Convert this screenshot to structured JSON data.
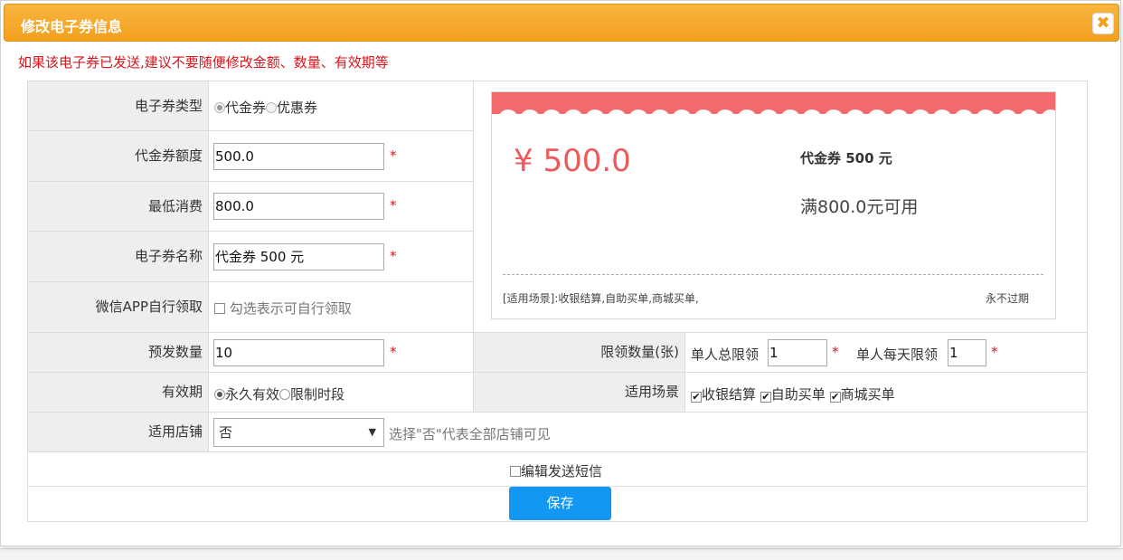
{
  "dialog": {
    "title": "修改电子券信息",
    "close_symbol": "✖",
    "warning": "如果该电子券已发送,建议不要随便修改金额、数量、有效期等"
  },
  "form": {
    "coupon_type": {
      "label": "电子券类型",
      "options": [
        "代金券",
        "优惠券"
      ],
      "selected": "代金券"
    },
    "amount": {
      "label": "代金券额度",
      "value": "500.0",
      "required": "*"
    },
    "min_spend": {
      "label": "最低消费",
      "value": "800.0",
      "required": "*"
    },
    "name": {
      "label": "电子券名称",
      "value": "代金券 500 元",
      "required": "*"
    },
    "wechat_self_claim": {
      "label": "微信APP自行领取",
      "checkbox_text": "勾选表示可自行领取",
      "checked": false
    },
    "preissue_qty": {
      "label": "预发数量",
      "value": "10",
      "required": "*"
    },
    "claim_limit": {
      "label": "限领数量(张)",
      "total_label": "单人总限领",
      "total_value": "1",
      "daily_label": "单人每天限领",
      "daily_value": "1",
      "required": "*"
    },
    "validity": {
      "label": "有效期",
      "options": [
        "永久有效",
        "限制时段"
      ],
      "selected": "永久有效"
    },
    "scenes": {
      "label": "适用场景",
      "options": [
        "收银结算",
        "自助买单",
        "商城买单"
      ],
      "checked": [
        true,
        true,
        true
      ],
      "check_mark": "✔"
    },
    "store": {
      "label": "适用店铺",
      "selected": "否",
      "hint": "选择\"否\"代表全部店铺可见",
      "arrow": "▼"
    },
    "sms": {
      "text": "编辑发送短信",
      "checked": false
    },
    "save_label": "保存"
  },
  "preview": {
    "amount": "¥ 500.0",
    "name": "代金券 500 元",
    "condition": "满800.0元可用",
    "scene": "[适用场景]:收银结算,自助买单,商城买单,",
    "expiry": "永不过期",
    "accent_color": "#f0595b"
  }
}
